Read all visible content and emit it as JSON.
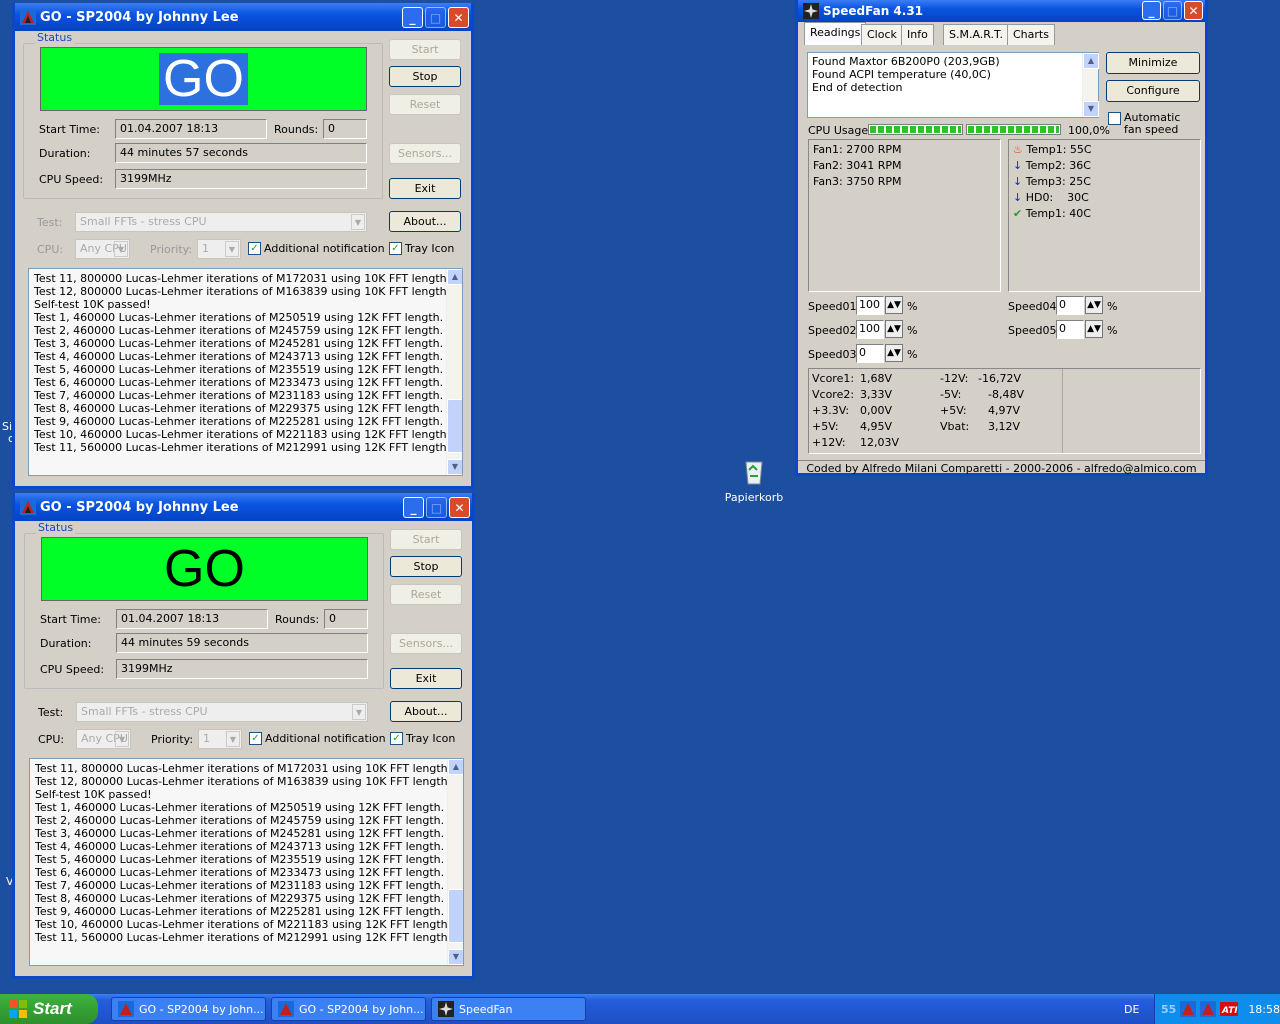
{
  "desktop": {
    "recycle_bin_label": "Papierkorb",
    "edge_text_1": "Si",
    "edge_text_2": "c",
    "edge_text_3": "V"
  },
  "prime_windows": [
    {
      "title": "GO - SP2004 by Johnny Lee",
      "status_group": "Status",
      "go_text": "GO",
      "start_time_label": "Start Time:",
      "start_time": "01.04.2007 18:13",
      "rounds_label": "Rounds:",
      "rounds": "0",
      "duration_label": "Duration:",
      "duration": "44 minutes 57 seconds",
      "cpu_speed_label": "CPU Speed:",
      "cpu_speed": "3199MHz",
      "buttons": {
        "start": "Start",
        "stop": "Stop",
        "reset": "Reset",
        "sensors": "Sensors...",
        "exit": "Exit",
        "about": "About..."
      },
      "test_label": "Test:",
      "test_value": "Small FFTs - stress CPU",
      "cpu_label": "CPU:",
      "cpu_value": "Any CPU",
      "priority_label": "Priority:",
      "priority_value": "1",
      "additional_notification": "Additional notification",
      "tray_icon": "Tray Icon",
      "log": [
        "Test 11, 800000 Lucas-Lehmer iterations of M172031 using 10K FFT length.",
        "Test 12, 800000 Lucas-Lehmer iterations of M163839 using 10K FFT length.",
        "Self-test 10K passed!",
        "Test 1, 460000 Lucas-Lehmer iterations of M250519 using 12K FFT length.",
        "Test 2, 460000 Lucas-Lehmer iterations of M245759 using 12K FFT length.",
        "Test 3, 460000 Lucas-Lehmer iterations of M245281 using 12K FFT length.",
        "Test 4, 460000 Lucas-Lehmer iterations of M243713 using 12K FFT length.",
        "Test 5, 460000 Lucas-Lehmer iterations of M235519 using 12K FFT length.",
        "Test 6, 460000 Lucas-Lehmer iterations of M233473 using 12K FFT length.",
        "Test 7, 460000 Lucas-Lehmer iterations of M231183 using 12K FFT length.",
        "Test 8, 460000 Lucas-Lehmer iterations of M229375 using 12K FFT length.",
        "Test 9, 460000 Lucas-Lehmer iterations of M225281 using 12K FFT length.",
        "Test 10, 460000 Lucas-Lehmer iterations of M221183 using 12K FFT length.",
        "Test 11, 560000 Lucas-Lehmer iterations of M212991 using 12K FFT length."
      ]
    },
    {
      "title": "GO - SP2004 by Johnny Lee",
      "status_group": "Status",
      "go_text": "GO",
      "start_time_label": "Start Time:",
      "start_time": "01.04.2007 18:13",
      "rounds_label": "Rounds:",
      "rounds": "0",
      "duration_label": "Duration:",
      "duration": "44 minutes 59 seconds",
      "cpu_speed_label": "CPU Speed:",
      "cpu_speed": "3199MHz",
      "buttons": {
        "start": "Start",
        "stop": "Stop",
        "reset": "Reset",
        "sensors": "Sensors...",
        "exit": "Exit",
        "about": "About..."
      },
      "test_label": "Test:",
      "test_value": "Small FFTs - stress CPU",
      "cpu_label": "CPU:",
      "cpu_value": "Any CPU",
      "priority_label": "Priority:",
      "priority_value": "1",
      "additional_notification": "Additional notification",
      "tray_icon": "Tray Icon",
      "log": [
        "Test 11, 800000 Lucas-Lehmer iterations of M172031 using 10K FFT length.",
        "Test 12, 800000 Lucas-Lehmer iterations of M163839 using 10K FFT length.",
        "Self-test 10K passed!",
        "Test 1, 460000 Lucas-Lehmer iterations of M250519 using 12K FFT length.",
        "Test 2, 460000 Lucas-Lehmer iterations of M245759 using 12K FFT length.",
        "Test 3, 460000 Lucas-Lehmer iterations of M245281 using 12K FFT length.",
        "Test 4, 460000 Lucas-Lehmer iterations of M243713 using 12K FFT length.",
        "Test 5, 460000 Lucas-Lehmer iterations of M235519 using 12K FFT length.",
        "Test 6, 460000 Lucas-Lehmer iterations of M233473 using 12K FFT length.",
        "Test 7, 460000 Lucas-Lehmer iterations of M231183 using 12K FFT length.",
        "Test 8, 460000 Lucas-Lehmer iterations of M229375 using 12K FFT length.",
        "Test 9, 460000 Lucas-Lehmer iterations of M225281 using 12K FFT length.",
        "Test 10, 460000 Lucas-Lehmer iterations of M221183 using 12K FFT length.",
        "Test 11, 560000 Lucas-Lehmer iterations of M212991 using 12K FFT length."
      ]
    }
  ],
  "speedfan": {
    "title": "SpeedFan 4.31",
    "tabs": [
      "Readings",
      "Clock",
      "Info",
      "S.M.A.R.T.",
      "Charts"
    ],
    "messages": [
      "Found Maxtor 6B200P0 (203,9GB)",
      "Found ACPI temperature (40,0C)",
      "End of detection"
    ],
    "minimize": "Minimize",
    "configure": "Configure",
    "automatic_fan_speed": "Automatic fan speed",
    "cpu_usage_label": "CPU Usage",
    "cpu_usage_value": "100,0%",
    "cpu_usage_fraction": [
      1.0,
      1.0
    ],
    "fans": [
      "Fan1: 2700 RPM",
      "Fan2: 3041 RPM",
      "Fan3: 3750 RPM"
    ],
    "temps": [
      {
        "label": "Temp1: 55C",
        "icon": "flame-icon"
      },
      {
        "label": "Temp2: 36C",
        "icon": "arrow-down-icon"
      },
      {
        "label": "Temp3: 25C",
        "icon": "arrow-down-icon"
      },
      {
        "label": "HD0:    30C",
        "icon": "arrow-down-icon"
      },
      {
        "label": "Temp1: 40C",
        "icon": "check-icon"
      }
    ],
    "speeds": [
      {
        "label": "Speed01:",
        "value": "100"
      },
      {
        "label": "Speed02:",
        "value": "100"
      },
      {
        "label": "Speed03:",
        "value": "0"
      },
      {
        "label": "Speed04:",
        "value": "0"
      },
      {
        "label": "Speed05:",
        "value": "0"
      }
    ],
    "percent": "%",
    "voltages_left": [
      {
        "label": "Vcore1:",
        "value": "1,68V"
      },
      {
        "label": "Vcore2:",
        "value": "3,33V"
      },
      {
        "label": "+3.3V:",
        "value": "0,00V"
      },
      {
        "label": "+5V:",
        "value": "4,95V"
      },
      {
        "label": "+12V:",
        "value": "12,03V"
      }
    ],
    "voltages_right": [
      {
        "label": "-12V:",
        "value": "-16,72V"
      },
      {
        "label": "-5V:",
        "value": "-8,48V"
      },
      {
        "label": "+5V:",
        "value": "4,97V"
      },
      {
        "label": "Vbat:",
        "value": "3,12V"
      }
    ],
    "footer": "Coded by Alfredo Milani Comparetti - 2000-2006 - alfredo@almico.com"
  },
  "taskbar": {
    "start": "Start",
    "items": [
      "GO - SP2004 by John...",
      "GO - SP2004 by John...",
      "SpeedFan"
    ],
    "lang": "DE",
    "tray_temp": "55",
    "clock": "18:58"
  },
  "colors": {
    "desktop": "#1c4fa0",
    "titlebar": "#0a54e0",
    "go_green": "#00ff26"
  }
}
